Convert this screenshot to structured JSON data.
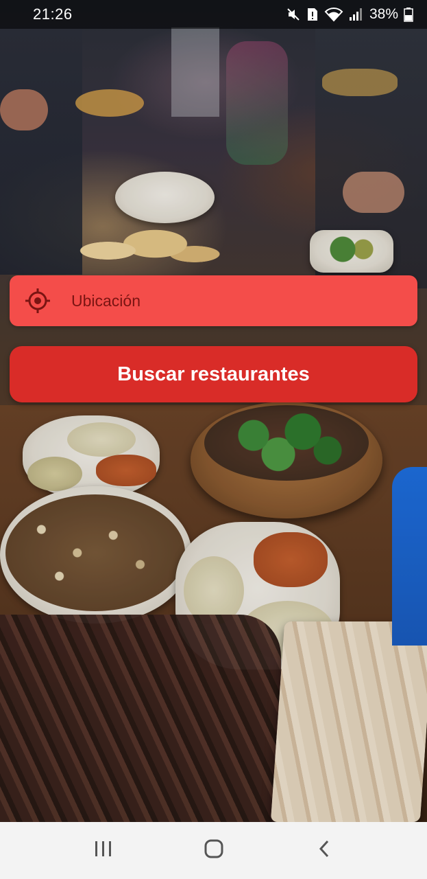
{
  "status_bar": {
    "time": "21:26",
    "battery_percent": "38%",
    "icons": [
      "mute-icon",
      "sim-alert-icon",
      "wifi-icon",
      "signal-icon",
      "battery-icon"
    ]
  },
  "location": {
    "placeholder": "Ubicación",
    "value": "",
    "icon": "crosshair-location-icon"
  },
  "search": {
    "button_label": "Buscar restaurantes"
  },
  "nav_bar": {
    "items": [
      "recent-apps-icon",
      "home-icon",
      "back-icon"
    ]
  },
  "colors": {
    "location_field_bg": "#f44d4a",
    "search_button_bg": "#d92c28",
    "nav_bar_bg": "#f3f3f3"
  }
}
